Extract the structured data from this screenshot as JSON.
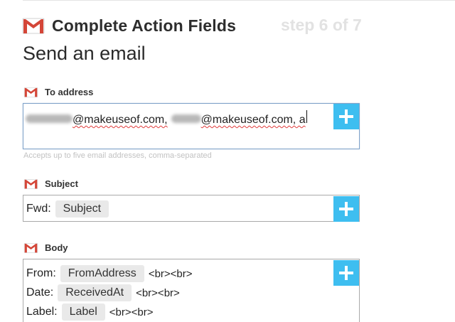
{
  "header": {
    "title": "Complete Action Fields",
    "step": "step 6 of 7"
  },
  "action": {
    "title": "Send an email"
  },
  "fields": {
    "to": {
      "label": "To address",
      "value_parts": [
        "@makeuseof.com,",
        "@makeuseof.com, a"
      ],
      "help": "Accepts up to five email addresses, comma-separated"
    },
    "subject": {
      "label": "Subject",
      "prefix": "Fwd:",
      "ingredient": "Subject"
    },
    "body": {
      "label": "Body",
      "lines": [
        {
          "prefix": "From:",
          "ingredient": "FromAddress",
          "suffix": "<br><br>"
        },
        {
          "prefix": "Date:",
          "ingredient": "ReceivedAt",
          "suffix": "<br><br>"
        },
        {
          "prefix": "Label:",
          "ingredient": "Label",
          "suffix": "<br><br>"
        }
      ]
    }
  },
  "icons": {
    "logo": "gmail-icon",
    "add": "plus-icon"
  },
  "colors": {
    "add_button": "#3ebef0",
    "gmail_red": "#d44638",
    "step_text": "#e2e2e2",
    "help_text": "#c2c2c2",
    "pill_bg": "#e9e9e9"
  }
}
